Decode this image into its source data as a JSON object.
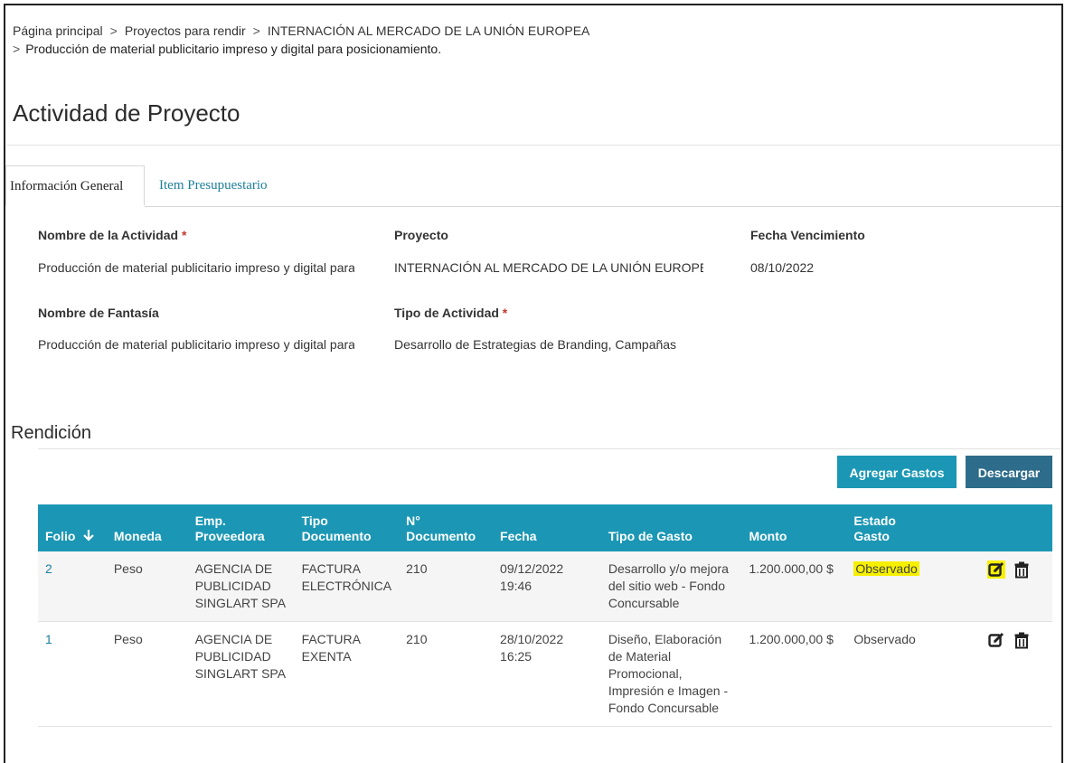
{
  "breadcrumb": {
    "items": [
      "Página principal",
      "Proyectos para rendir",
      "INTERNACIÓN AL MERCADO DE LA UNIÓN EUROPEA"
    ],
    "current": "Producción de material publicitario impreso y digital para posicionamiento.",
    "separator": ">"
  },
  "page": {
    "title": "Actividad de Proyecto"
  },
  "tabs": [
    {
      "label": "Información General"
    },
    {
      "label": "Item Presupuestario"
    }
  ],
  "form": {
    "actividad": {
      "label": "Nombre de la Actividad",
      "required": "*",
      "value": "Producción de material publicitario impreso y digital para posicionamiento."
    },
    "proyecto": {
      "label": "Proyecto",
      "value": "INTERNACIÓN AL MERCADO DE LA UNIÓN EUROPEA"
    },
    "vencimiento": {
      "label": "Fecha Vencimiento",
      "value": "08/10/2022"
    },
    "fantasia": {
      "label": "Nombre de Fantasía",
      "value": "Producción de material publicitario impreso y digital para posicionamiento."
    },
    "tipo_actividad": {
      "label": "Tipo de Actividad",
      "required": "*",
      "value": "Desarrollo de Estrategias de Branding, Campañas"
    }
  },
  "rendicion": {
    "title": "Rendición",
    "buttons": {
      "agregar": "Agregar Gastos",
      "descargar": "Descargar"
    },
    "columns": {
      "folio": "Folio",
      "moneda": "Moneda",
      "proveedora_1": "Emp.",
      "proveedora_2": "Proveedora",
      "tipo_doc_1": "Tipo",
      "tipo_doc_2": "Documento",
      "num_doc_1": "N°",
      "num_doc_2": "Documento",
      "fecha": "Fecha",
      "tipo_gasto": "Tipo de Gasto",
      "monto": "Monto",
      "estado_1": "Estado",
      "estado_2": "Gasto"
    },
    "rows": [
      {
        "folio": "2",
        "moneda": "Peso",
        "proveedora": "AGENCIA DE PUBLICIDAD SINGLART SPA",
        "tipo_doc": "FACTURA ELECTRÓNICA",
        "num_doc": "210",
        "fecha": "09/12/2022 19:46",
        "tipo_gasto": "Desarrollo y/o mejora del sitio web - Fondo Concursable",
        "monto": "1.200.000,00 $",
        "estado": "Observado"
      },
      {
        "folio": "1",
        "moneda": "Peso",
        "proveedora": "AGENCIA DE PUBLICIDAD SINGLART SPA",
        "tipo_doc": "FACTURA EXENTA",
        "num_doc": "210",
        "fecha": "28/10/2022 16:25",
        "tipo_gasto": "Diseño, Elaboración de Material Promocional, Impresión e Imagen - Fondo Concursable",
        "monto": "1.200.000,00 $",
        "estado": "Observado"
      }
    ]
  },
  "colors": {
    "accent": "#1b97b5",
    "accent_dark": "#2d6c8a",
    "highlight": "#f6f000",
    "link": "#1e7f9b"
  },
  "icons": {
    "sort": "arrow-down-icon",
    "edit": "edit-icon",
    "delete": "trash-icon"
  }
}
